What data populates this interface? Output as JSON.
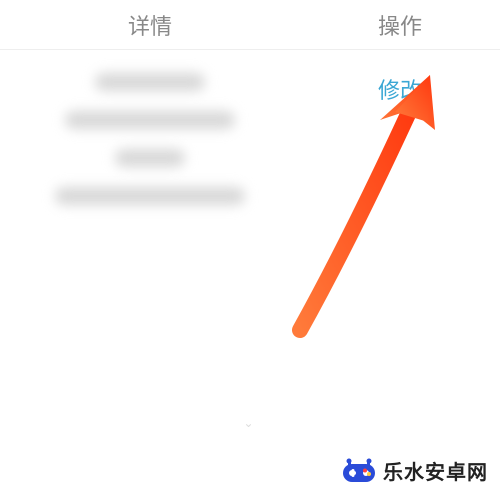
{
  "header": {
    "details_label": "详情",
    "action_label": "操作"
  },
  "row": {
    "modify_label": "修改"
  },
  "watermark": {
    "text": "乐水安卓网"
  },
  "colors": {
    "link": "#3ba7d4",
    "arrow": "#ff4a1a"
  }
}
